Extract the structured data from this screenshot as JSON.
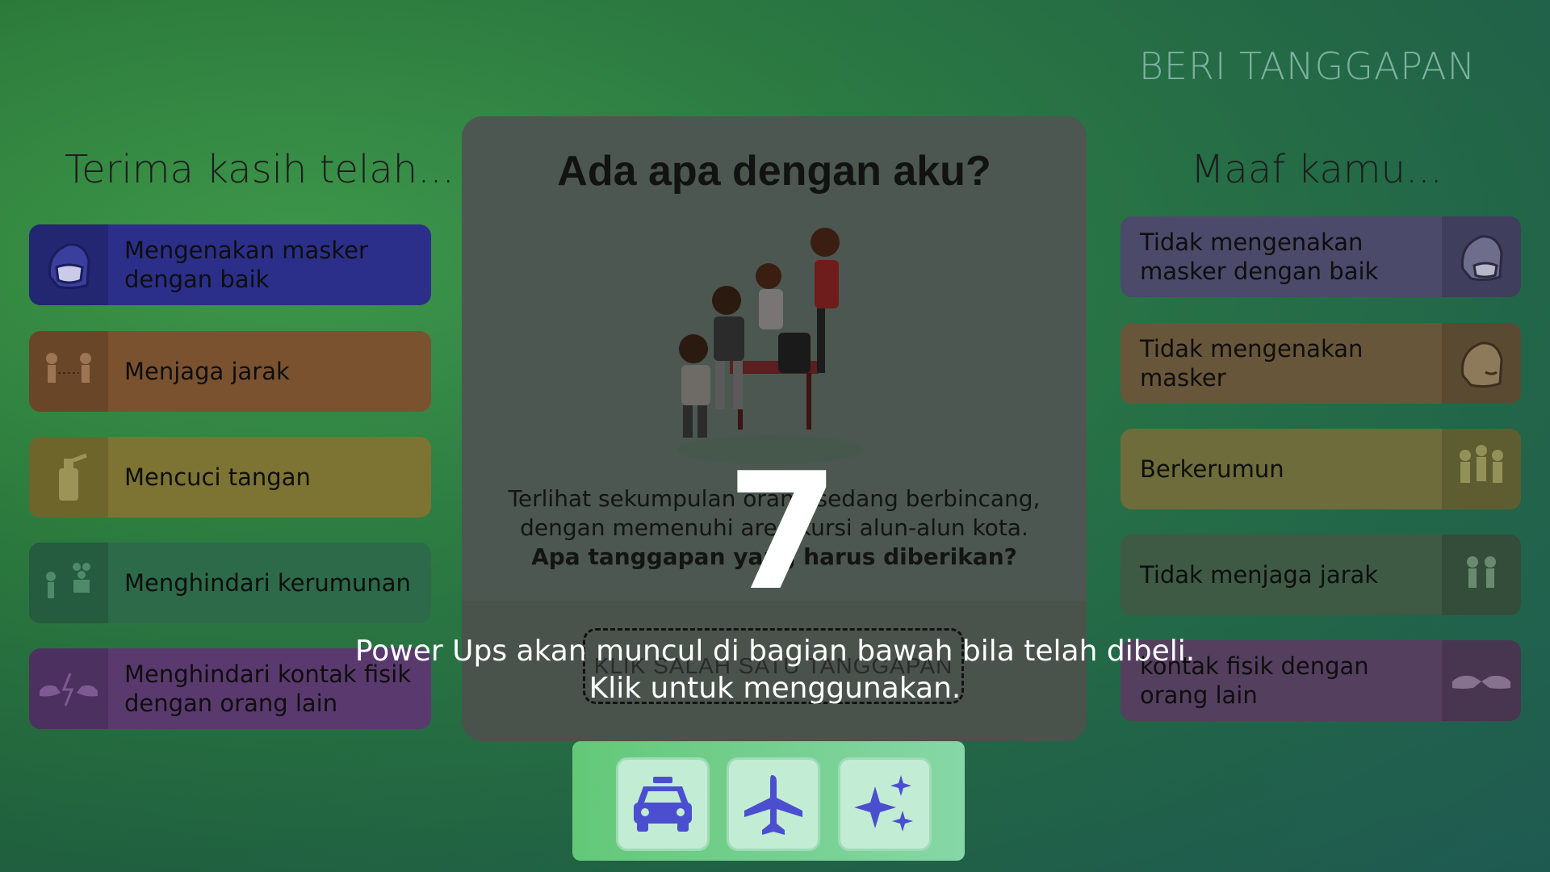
{
  "header": {
    "title": "BERI TANGGAPAN"
  },
  "left_column": {
    "title": "Terima kasih telah...",
    "items": [
      {
        "label": "Mengenakan masker dengan baik",
        "icon": "mask-face-icon",
        "color": "#2b2f8a"
      },
      {
        "label": "Menjaga jarak",
        "icon": "keep-distance-icon",
        "color": "#7a5230"
      },
      {
        "label": "Mencuci tangan",
        "icon": "hand-sanitizer-icon",
        "color": "#7d7433"
      },
      {
        "label": "Menghindari kerumunan",
        "icon": "avoid-crowd-icon",
        "color": "#2d6a4a"
      },
      {
        "label": "Menghindari kontak fisik dengan orang lain",
        "icon": "no-contact-icon",
        "color": "#5a3a6e"
      }
    ]
  },
  "right_column": {
    "title": "Maaf kamu...",
    "items": [
      {
        "label": "Tidak mengenakan masker dengan baik",
        "icon": "mask-face-icon",
        "color": "#4b4a6a"
      },
      {
        "label": "Tidak mengenakan masker",
        "icon": "no-mask-face-icon",
        "color": "#68563a"
      },
      {
        "label": "Berkerumun",
        "icon": "crowd-icon",
        "color": "#6d6c3a"
      },
      {
        "label": "Tidak menjaga jarak",
        "icon": "close-distance-icon",
        "color": "#3e5a44"
      },
      {
        "label": "kontak fisik dengan orang lain",
        "icon": "handshake-icon",
        "color": "#553f5e"
      }
    ]
  },
  "modal": {
    "title": "Ada apa dengan aku?",
    "description_line1": "Terlihat sekumpulan orang sedang berbincang,",
    "description_line2": "dengan memenuhi area kursi alun-alun kota.",
    "question": "Apa tanggapan yang harus diberikan?",
    "answer_placeholder": "KLIK SALAH SATU TANGGAPAN"
  },
  "countdown": "7",
  "hint": {
    "line1": "Power Ups akan muncul di bagian bawah bila telah dibeli.",
    "line2": "Klik untuk menggunakan."
  },
  "powerups": [
    {
      "icon": "taxi-icon"
    },
    {
      "icon": "airplane-icon"
    },
    {
      "icon": "sparkles-icon"
    }
  ],
  "colors": {
    "powerup_icon": "#4b4fcf",
    "modal_bg": "#4a524c"
  }
}
